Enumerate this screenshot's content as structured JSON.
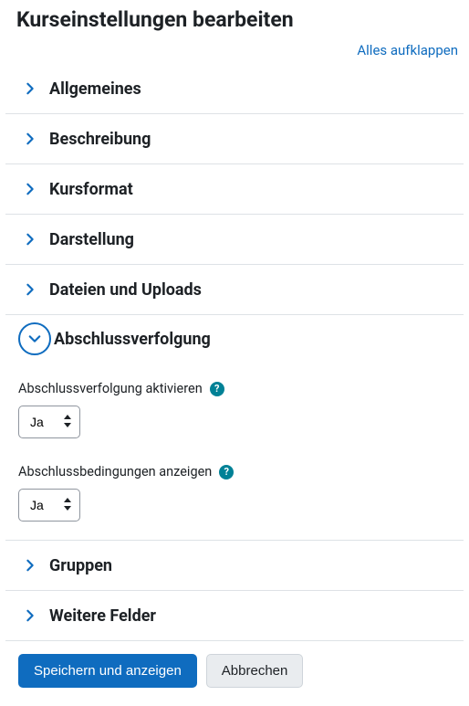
{
  "page_title": "Kurseinstellungen bearbeiten",
  "expand_all": "Alles aufklappen",
  "sections": {
    "general": "Allgemeines",
    "description": "Beschreibung",
    "format": "Kursformat",
    "appearance": "Darstellung",
    "files": "Dateien und Uploads",
    "completion": "Abschlussverfolgung",
    "groups": "Gruppen",
    "other": "Weitere Felder"
  },
  "completion_form": {
    "enable_label": "Abschlussverfolgung aktivieren",
    "enable_value": "Ja",
    "show_conditions_label": "Abschlussbedingungen anzeigen",
    "show_conditions_value": "Ja"
  },
  "actions": {
    "save_display": "Speichern und anzeigen",
    "cancel": "Abbrechen"
  }
}
